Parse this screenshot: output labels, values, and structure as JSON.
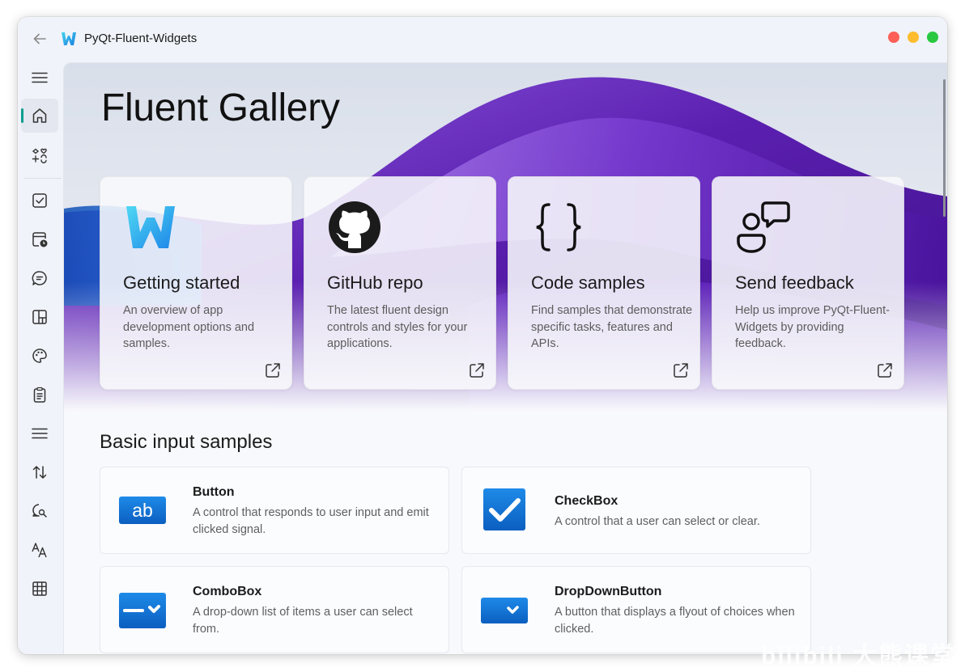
{
  "window": {
    "title": "PyQt-Fluent-Widgets"
  },
  "nav": {
    "items": [
      {
        "name": "menu",
        "icon": "hamburger-menu-icon"
      },
      {
        "name": "home",
        "icon": "home-icon",
        "active": true
      },
      {
        "name": "icons",
        "icon": "icon-gallery-icon"
      },
      {
        "name": "basic-input",
        "icon": "checkbox-icon"
      },
      {
        "name": "date-time",
        "icon": "calendar-clock-icon"
      },
      {
        "name": "dialog",
        "icon": "chat-bubble-icon"
      },
      {
        "name": "layout",
        "icon": "layout-icon"
      },
      {
        "name": "material",
        "icon": "palette-icon"
      },
      {
        "name": "menu-list",
        "icon": "clipboard-icon"
      },
      {
        "name": "navigation",
        "icon": "list-icon"
      },
      {
        "name": "scroll",
        "icon": "sort-arrows-icon"
      },
      {
        "name": "status-info",
        "icon": "chat-search-icon"
      },
      {
        "name": "text",
        "icon": "text-font-icon"
      },
      {
        "name": "view",
        "icon": "grid-icon"
      }
    ]
  },
  "hero": {
    "title": "Fluent Gallery"
  },
  "link_cards": [
    {
      "title": "Getting started",
      "desc": "An overview of app development options and samples.",
      "icon": "fluent-logo-icon"
    },
    {
      "title": "GitHub repo",
      "desc": "The latest fluent design controls and styles for your applications.",
      "icon": "github-icon"
    },
    {
      "title": "Code samples",
      "desc": "Find samples that demonstrate specific tasks, features and APIs.",
      "icon": "code-braces-icon"
    },
    {
      "title": "Send feedback",
      "desc": "Help us improve PyQt-Fluent-Widgets by providing feedback.",
      "icon": "feedback-icon"
    }
  ],
  "section": {
    "title": "Basic input samples"
  },
  "samples": [
    {
      "title": "Button",
      "desc": "A control that responds to user input and emit clicked signal.",
      "icon": "button-ab-icon",
      "icon_text": "ab"
    },
    {
      "title": "CheckBox",
      "desc": "A control that a user can select or clear.",
      "icon": "checkbox-check-icon"
    },
    {
      "title": "ComboBox",
      "desc": "A drop-down list of items a user can select from.",
      "icon": "combobox-icon"
    },
    {
      "title": "DropDownButton",
      "desc": "A button that displays a flyout of choices when clicked.",
      "icon": "dropdown-button-icon"
    }
  ],
  "watermark": "bilibili 大熊课堂",
  "colors": {
    "accent": "#0a9e8f",
    "hero_purple": "#5b1fb0",
    "sample_blue": "#0e74d6"
  }
}
